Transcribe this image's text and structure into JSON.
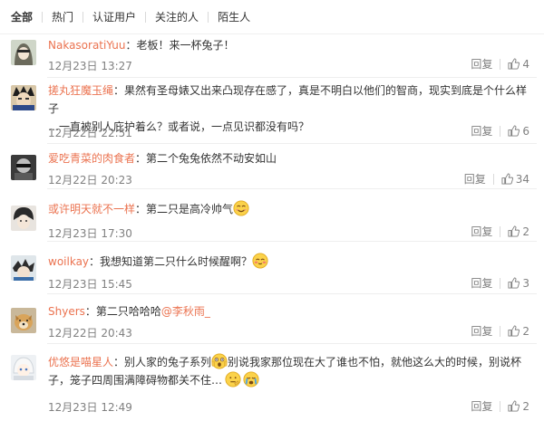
{
  "tabs": [
    {
      "label": "全部"
    },
    {
      "label": "热门"
    },
    {
      "label": "认证用户"
    },
    {
      "label": "关注的人"
    },
    {
      "label": "陌生人"
    }
  ],
  "reply_label": "回复",
  "comments": [
    {
      "author": "NakasoratiYuu",
      "text": "：老板！来一杯兔子！",
      "time": "12月23日 13:27",
      "likes": "4"
    },
    {
      "author": "搓丸狂魔玉绳",
      "text_line1": "：果然有圣母婊又出来凸现存在感了，真是不明白以他们的智商，现实到底是个什么样子",
      "text_line2": "…一直被别人庇护着么？或者说，一点见识都没有吗？",
      "time": "12月22日 22:51",
      "likes": "6"
    },
    {
      "author": "爱吃青菜的肉食者",
      "text": "：第二个兔兔依然不动安如山",
      "time": "12月22日 20:23",
      "likes": "34"
    },
    {
      "author": "或许明天就不一样",
      "text": "：第二只是高冷帅气",
      "emoji": "smile-emoji",
      "time": "12月23日 17:30",
      "likes": "2"
    },
    {
      "author": "woilkay",
      "text": "：我想知道第二只什么时候醒啊？",
      "emoji": "blush-emoji",
      "time": "12月23日 15:45",
      "likes": "3"
    },
    {
      "author": "Shyers",
      "text": "：第二只哈哈哈",
      "mention": "@李秋雨_",
      "time": "12月22日 20:43",
      "likes": "2"
    },
    {
      "author": "优悠是喵星人",
      "text_part1": "：别人家的兔子系列",
      "text_part2": "别说我家那位现在大了谁也不怕，就他这么大的时候，别说杯",
      "text_line2": "子，笼子四周围满障碍物都关不住…",
      "emojis": [
        "shocked-emoji",
        "thinking-emoji",
        "crying-emoji"
      ],
      "time": "12月23日 12:49",
      "likes": "2"
    }
  ],
  "colors": {
    "author": "#eb7350",
    "text": "#333333",
    "meta": "#808080"
  },
  "icons": {
    "like": "thumbs-up-icon"
  }
}
